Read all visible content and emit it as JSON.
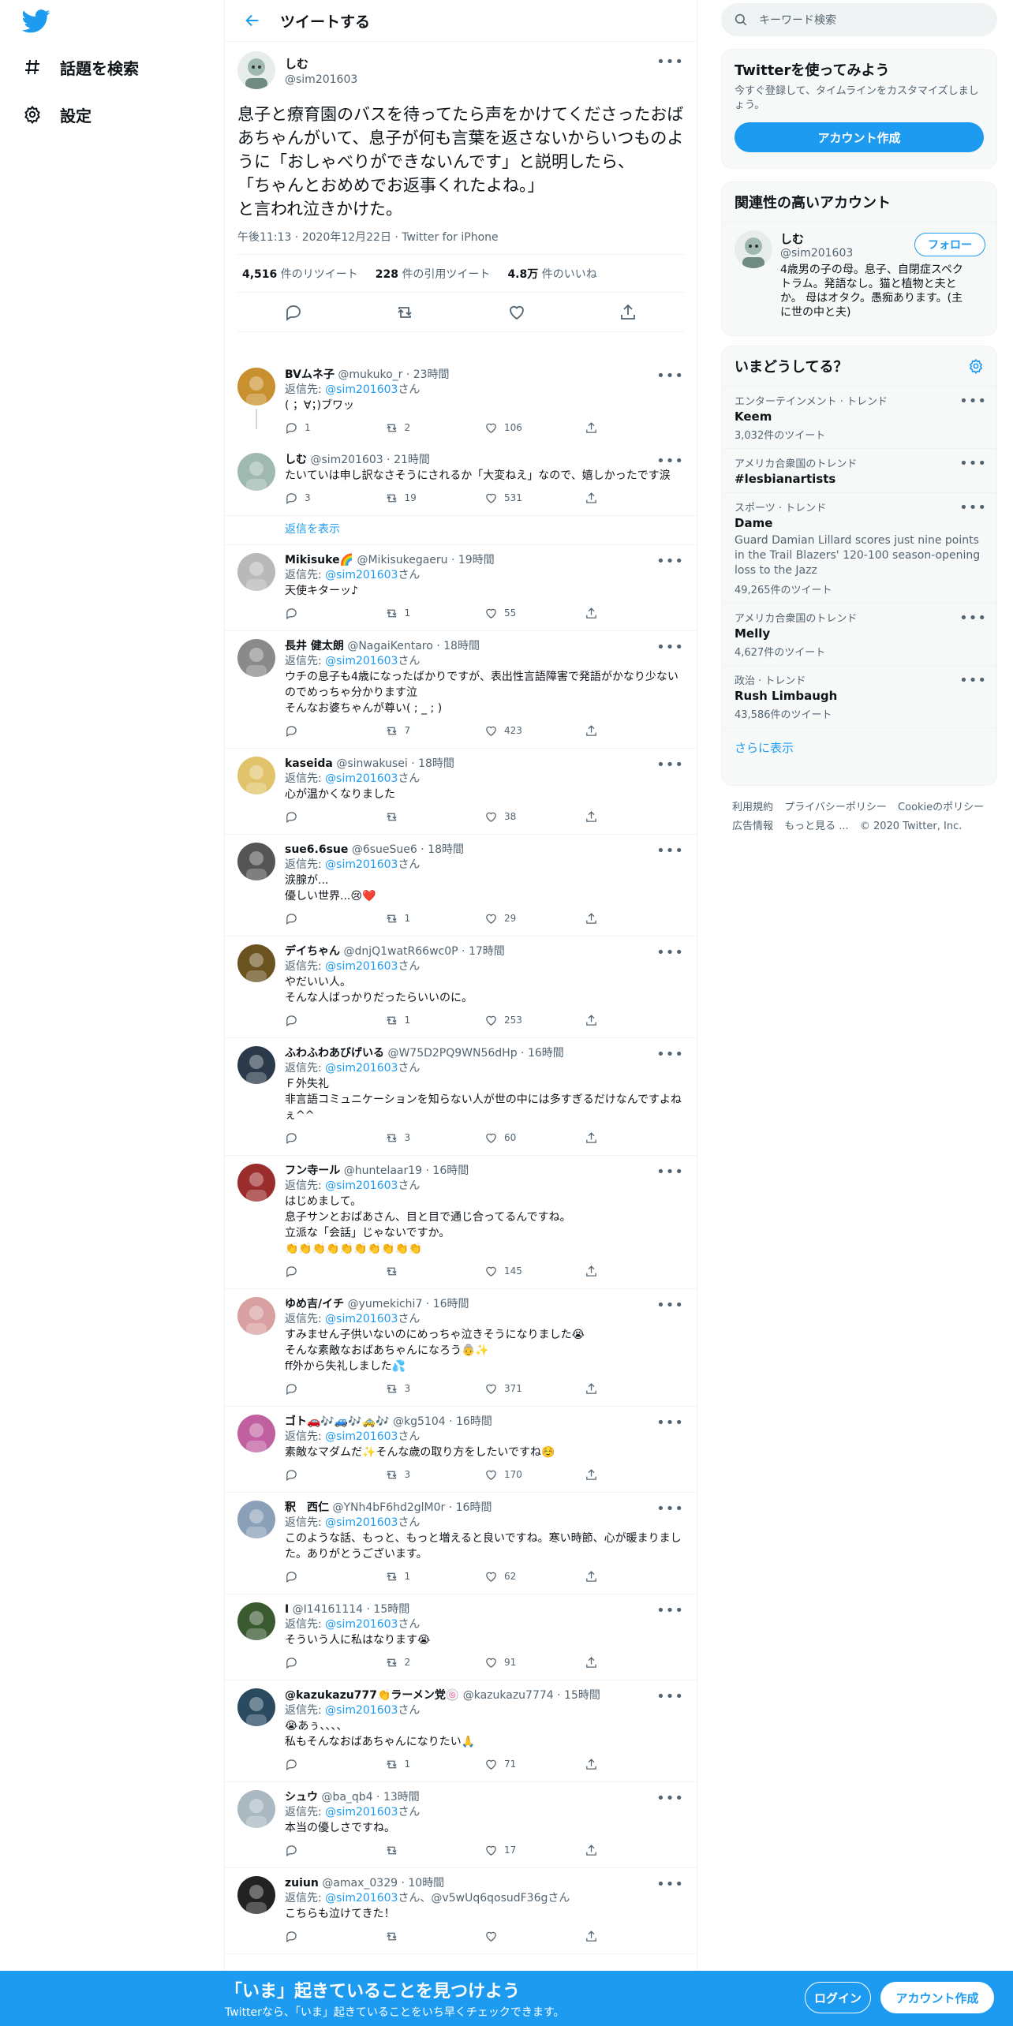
{
  "colors": {
    "accent": "#1d9bf0",
    "text": "#0f1419",
    "muted": "#536471"
  },
  "nav": {
    "explore": "話題を検索",
    "settings": "設定"
  },
  "header": {
    "title": "ツイートする"
  },
  "focus": {
    "name": "しむ",
    "handle": "@sim201603",
    "text": "息子と療育園のバスを待ってたら声をかけてくださったおばあちゃんがいて、息子が何も言葉を返さないからいつものように「おしゃべりができないんです」と説明したら、\n「ちゃんとおめめでお返事くれたよね。」\nと言われ泣きかけた。",
    "time": "午後11:13 · 2020年12月22日 · Twitter for iPhone",
    "retweets_num": "4,516",
    "retweets_label": "件のリツイート",
    "quotes_num": "228",
    "quotes_label": "件の引用ツイート",
    "likes_num": "4.8万",
    "likes_label": "件のいいね"
  },
  "replies": [
    {
      "name": "BVムネ子",
      "meta": "@mukuko_r · 23時間",
      "to_prefix": "返信先: ",
      "to": "@sim201603",
      "to_suffix": "さん",
      "text": "( ；∀；)ブワッ",
      "reply": "1",
      "rt": "2",
      "like": "106",
      "avatar": "#c8902e"
    },
    {
      "name": "しむ",
      "meta": "@sim201603 · 21時間",
      "to_prefix": "",
      "to": "",
      "to_suffix": "",
      "text": "たいていは申し訳なさそうにされるか「大変ねえ」なので、嬉しかったです涙",
      "reply": "3",
      "rt": "19",
      "like": "531",
      "avatar": "#9fb8b0"
    },
    {
      "name": "Mikisuke🌈",
      "meta": "@Mikisukegaeru · 19時間",
      "to_prefix": "返信先: ",
      "to": "@sim201603",
      "to_suffix": "さん",
      "text": "天使キターッ♪",
      "reply": "",
      "rt": "1",
      "like": "55",
      "avatar": "#b9b9b9"
    },
    {
      "name": "長井 健太朗",
      "meta": "@NagaiKentaro · 18時間",
      "to_prefix": "返信先: ",
      "to": "@sim201603",
      "to_suffix": "さん",
      "text": "ウチの息子も4歳になったばかりですが、表出性言語障害で発語がかなり少ないのでめっちゃ分かります泣\nそんなお婆ちゃんが尊い( ; _ ; )",
      "reply": "",
      "rt": "7",
      "like": "423",
      "avatar": "#8a8a8a"
    },
    {
      "name": "kaseida",
      "meta": "@sinwakusei · 18時間",
      "to_prefix": "返信先: ",
      "to": "@sim201603",
      "to_suffix": "さん",
      "text": "心が温かくなりました",
      "reply": "",
      "rt": "",
      "like": "38",
      "avatar": "#e0c36a"
    },
    {
      "name": "sue6.6sue",
      "meta": "@6sueSue6 · 18時間",
      "to_prefix": "返信先: ",
      "to": "@sim201603",
      "to_suffix": "さん",
      "text": "涙腺が...\n優しい世界...😢❤️",
      "reply": "",
      "rt": "1",
      "like": "29",
      "avatar": "#555555"
    },
    {
      "name": "デイちゃん",
      "meta": "@dnjQ1watR66wc0P · 17時間",
      "to_prefix": "返信先: ",
      "to": "@sim201603",
      "to_suffix": "さん",
      "text": "やだいい人。\nそんな人ばっかりだったらいいのに。",
      "reply": "",
      "rt": "1",
      "like": "253",
      "avatar": "#6b5320"
    },
    {
      "name": "ふわふわあびげいる",
      "meta": "@W75D2PQ9WN56dHp · 16時間",
      "to_prefix": "返信先: ",
      "to": "@sim201603",
      "to_suffix": "さん",
      "text": "Ｆ外失礼\n非言語コミュニケーションを知らない人が世の中には多すぎるだけなんですよねぇ^^",
      "reply": "",
      "rt": "3",
      "like": "60",
      "avatar": "#2a3a4a"
    },
    {
      "name": "フン寺ール",
      "meta": "@huntelaar19 · 16時間",
      "to_prefix": "返信先: ",
      "to": "@sim201603",
      "to_suffix": "さん",
      "text": "はじめまして。\n息子サンとおばあさん、目と目で通じ合ってるんですね。\n立派な「会話」じゃないですか。\n👏👏👏👏👏👏👏👏👏👏",
      "reply": "",
      "rt": "",
      "like": "145",
      "avatar": "#9a2c2c"
    },
    {
      "name": "ゆめ吉/イチ",
      "meta": "@yumekichi7 · 16時間",
      "to_prefix": "返信先: ",
      "to": "@sim201603",
      "to_suffix": "さん",
      "text": "すみません子供いないのにめっちゃ泣きそうになりました😭\nそんな素敵なおばあちゃんになろう👵✨\nff外から失礼しました💦",
      "reply": "",
      "rt": "3",
      "like": "371",
      "avatar": "#d8a0a0"
    },
    {
      "name": "ゴト🚗🎶🚙🎶🚕🎶",
      "meta": "@kg5104 · 16時間",
      "to_prefix": "返信先: ",
      "to": "@sim201603",
      "to_suffix": "さん",
      "text": "素敵なマダムだ✨そんな歳の取り方をしたいですね☺️",
      "reply": "",
      "rt": "3",
      "like": "170",
      "avatar": "#c060a0"
    },
    {
      "name": "釈　西仁",
      "meta": "@YNh4bF6hd2glM0r · 16時間",
      "to_prefix": "返信先: ",
      "to": "@sim201603",
      "to_suffix": "さん",
      "text": "このような話、もっと、もっと増えると良いですね。寒い時節、心が暖まりました。ありがとうございます。",
      "reply": "",
      "rt": "1",
      "like": "62",
      "avatar": "#8aa0b8"
    },
    {
      "name": "I",
      "meta": "@I14161114 · 15時間",
      "to_prefix": "返信先: ",
      "to": "@sim201603",
      "to_suffix": "さん",
      "text": "そういう人に私はなります😭",
      "reply": "",
      "rt": "2",
      "like": "91",
      "avatar": "#3a5a30"
    },
    {
      "name": "@kazukazu777👏ラーメン党🍥",
      "meta": "@kazukazu7774 · 15時間",
      "to_prefix": "返信先: ",
      "to": "@sim201603",
      "to_suffix": "さん",
      "text": "😭あぅ、、、、\n私もそんなおばあちゃんになりたい🙏",
      "reply": "",
      "rt": "1",
      "like": "71",
      "avatar": "#2a4a60"
    },
    {
      "name": "シュウ",
      "meta": "@ba_qb4 · 13時間",
      "to_prefix": "返信先: ",
      "to": "@sim201603",
      "to_suffix": "さん",
      "text": "本当の優しさですね。",
      "reply": "",
      "rt": "",
      "like": "17",
      "avatar": "#aab8c2"
    },
    {
      "name": "zuiun",
      "meta": "@amax_0329 · 10時間",
      "to_prefix": "返信先: ",
      "to": "@sim201603",
      "to_suffix": "さん、@v5wUq6qosudF36gさん",
      "text": "こちらも泣けてきた！",
      "reply": "",
      "rt": "",
      "like": "",
      "avatar": "#222222"
    }
  ],
  "show_replies": "返信を表示",
  "search": {
    "placeholder": "キーワード検索"
  },
  "signup_card": {
    "title": "Twitterを使ってみよう",
    "sub": "今すぐ登録して、タイムラインをカスタマイズしましょう。",
    "button": "アカウント作成"
  },
  "related": {
    "title": "関連性の高いアカウント",
    "name": "しむ",
    "handle": "@sim201603",
    "follow": "フォロー",
    "bio": "4歳男の子の母。息子、自閉症スペクトラム。発語なし。猫と植物と夫とか。 母はオタク。愚痴あります。(主に世の中と夫)"
  },
  "trends": {
    "title": "いまどうしてる？",
    "show_more": "さらに表示",
    "items": [
      {
        "cat": "エンターテインメント · トレンド",
        "name": "Keem",
        "desc": "",
        "count": "3,032件のツイート"
      },
      {
        "cat": "アメリカ合衆国のトレンド",
        "name": "#lesbianartists",
        "desc": "",
        "count": ""
      },
      {
        "cat": "スポーツ · トレンド",
        "name": "Dame",
        "desc": "Guard Damian Lillard scores just nine points in the Trail Blazers' 120-100 season-opening loss to the Jazz",
        "count": "49,265件のツイート"
      },
      {
        "cat": "アメリカ合衆国のトレンド",
        "name": "Melly",
        "desc": "",
        "count": "4,627件のツイート"
      },
      {
        "cat": "政治 · トレンド",
        "name": "Rush Limbaugh",
        "desc": "",
        "count": "43,586件のツイート"
      }
    ]
  },
  "footer": {
    "terms": "利用規約",
    "privacy": "プライバシーポリシー",
    "cookie": "Cookieのポリシー",
    "ads": "広告情報",
    "more": "もっと見る ...",
    "copyright": "© 2020 Twitter, Inc."
  },
  "bottombar": {
    "title": "「いま」起きていることを見つけよう",
    "sub": "Twitterなら、「いま」起きていることをいち早くチェックできます。",
    "login": "ログイン",
    "signup": "アカウント作成"
  }
}
